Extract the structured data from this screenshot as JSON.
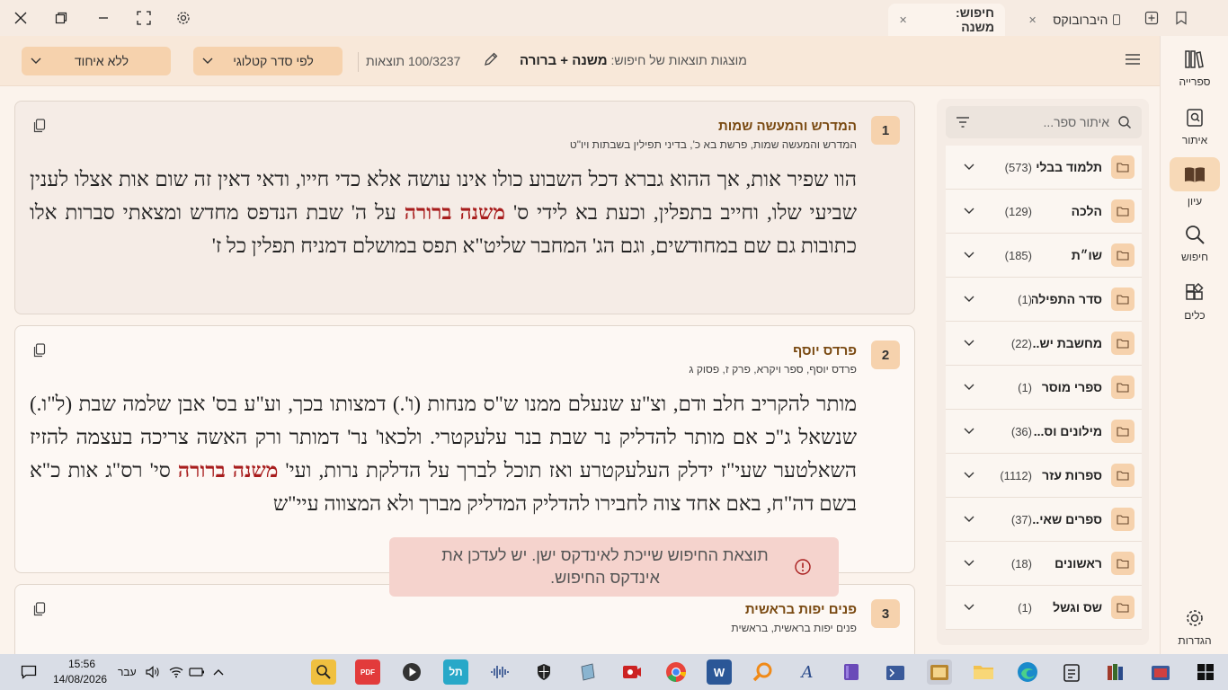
{
  "tabs": [
    {
      "label": "חיפוש: משנה",
      "active": true
    },
    {
      "label": "היברובוקס",
      "active": false
    }
  ],
  "header": {
    "ungroup_label": "ללא איחוד",
    "sort_label": "לפי סדר קטלוגי",
    "results_count": "100/3237 תוצאות",
    "results_prefix": "מוצגות תוצאות של חיפוש:",
    "query": "משנה + ברורה"
  },
  "rail": [
    {
      "label": "ספרייה",
      "icon": "library-icon"
    },
    {
      "label": "איתור",
      "icon": "locate-book-icon"
    },
    {
      "label": "עיון",
      "icon": "open-book-icon",
      "active": true
    },
    {
      "label": "חיפוש",
      "icon": "search-icon"
    },
    {
      "label": "כלים",
      "icon": "tools-icon"
    },
    {
      "label": "הגדרות",
      "icon": "gear-icon"
    }
  ],
  "sidebar": {
    "filter_placeholder": "איתור ספר...",
    "categories": [
      {
        "name": "תלמוד בבלי",
        "count": "(573)"
      },
      {
        "name": "הלכה",
        "count": "(129)"
      },
      {
        "name": "שו״ת",
        "count": "(185)"
      },
      {
        "name": "סדר התפילה",
        "count": "(1)"
      },
      {
        "name": "מחשבת יש...",
        "count": "(22)"
      },
      {
        "name": "ספרי מוסר",
        "count": "(1)"
      },
      {
        "name": "מילונים וס...",
        "count": "(36)"
      },
      {
        "name": "ספרות עזר",
        "count": "(1112)"
      },
      {
        "name": "ספרים שאי...",
        "count": "(37)"
      },
      {
        "name": "ראשונים",
        "count": "(18)"
      },
      {
        "name": "שס וגשל",
        "count": "(1)"
      }
    ]
  },
  "results": [
    {
      "num": "1",
      "title": "המדרש והמעשה שמות",
      "path": "המדרש והמעשה שמות, פרשת בא כ', בדיני תפילין בשבתות ויו\"ט",
      "text_before": "הוו שפיר אות, אך ההוא גברא דכל השבוע כולו אינו עושה אלא כדי חייו, ודאי דאין זה שום אות אצלו לענין שביעי שלו, וחייב בתפלין, וכעת בא לידי ס' ",
      "highlight": "משנה ברורה",
      "text_after": " על ה' שבת הנדפס מחדש ומצאתי סברות אלו כתובות גם שם במחודשים, וגם הג' המחבר שליט\"א תפס במושלם דמניח תפלין כל ז'"
    },
    {
      "num": "2",
      "title": "פרדס יוסף",
      "path": "פרדס יוסף, ספר ויקרא, פרק ז, פסוק ג",
      "text_before": "מותר להקריב חלב ודם, וצ\"ע שנעלם ממנו ש\"ס מנחות (ו'.) דמצותו בכך, וע\"ע בס' אבן שלמה שבת (ל\"ו.) שנשאל ג\"כ אם מותר להדליק נר שבת בנר עלעקטרי. ולכאו' נר' דמותר ורק האשה צריכה בעצמה להזיז השאלטער שעי\"ז ידלק העלעקטרע ואז תוכל לברך על הדלקת נרות, ועי' ",
      "highlight": "משנה ברורה",
      "text_after": " סי' רס\"ג אות כ\"א בשם דה\"ח, באם אחד צוה לחבירו להדליק המדליק מברך ולא המצווה עיי\"ש"
    },
    {
      "num": "3",
      "title": "פנים יפות בראשית",
      "path": "פנים יפות בראשית, בראשית",
      "text_before": "",
      "highlight": "",
      "text_after": ""
    }
  ],
  "toast": {
    "message": "תוצאת החיפוש שייכת לאינדקס ישן. יש לעדכן את אינדקס החיפוש."
  },
  "taskbar": {
    "time": "15:56",
    "date": "14/08/2026",
    "lang": "עבר"
  }
}
